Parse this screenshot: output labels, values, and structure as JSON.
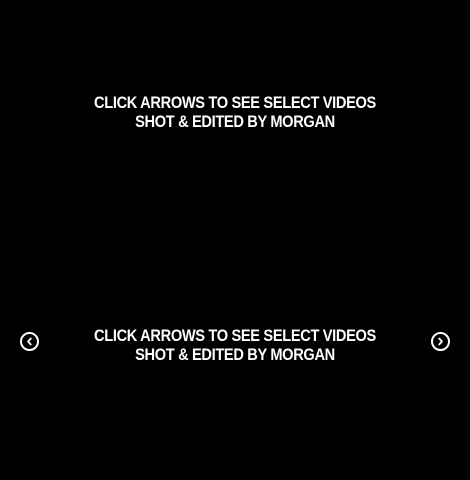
{
  "slides": [
    {
      "line1": "CLICK  ARROWS TO SEE SELECT VIDEOS",
      "line2": "SHOT & EDITED BY MORGAN"
    },
    {
      "line1": "CLICK  ARROWS TO SEE SELECT VIDEOS",
      "line2": "SHOT & EDITED BY MORGAN"
    }
  ],
  "controls": {
    "prev_icon": "chevron-left-circle-icon",
    "next_icon": "chevron-right-circle-icon"
  },
  "colors": {
    "background": "#000000",
    "text": "#ffffff"
  }
}
